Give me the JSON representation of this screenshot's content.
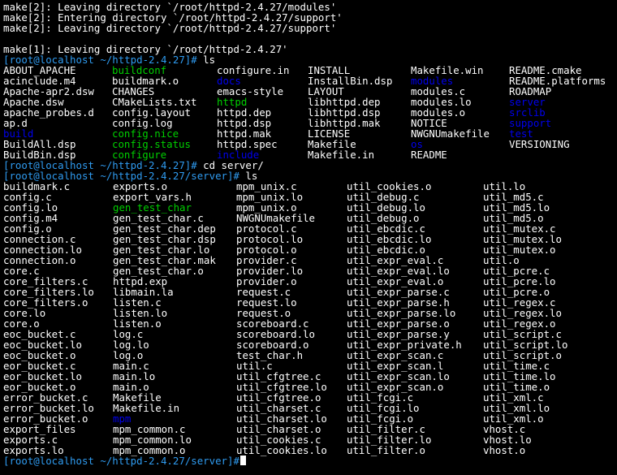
{
  "colors": {
    "background": "#000000",
    "text": "#ffffff",
    "prompt": "#2f9bf0",
    "directory": "#0000ee",
    "executable": "#00d000",
    "symlink": "#00ced1"
  },
  "make_lines": [
    "make[2]: Leaving directory `/root/httpd-2.4.27/modules'",
    "make[2]: Entering directory `/root/httpd-2.4.27/support'",
    "make[2]: Leaving directory `/root/httpd-2.4.27/support'",
    "",
    "make[1]: Leaving directory `/root/httpd-2.4.27'"
  ],
  "commands": [
    {
      "prompt": "[root@localhost ~/httpd-2.4.27]#",
      "command": " ls"
    },
    {
      "prompt": "[root@localhost ~/httpd-2.4.27]#",
      "command": " cd server/"
    },
    {
      "prompt": "[root@localhost ~/httpd-2.4.27/server]#",
      "command": " ls"
    },
    {
      "prompt": "[root@localhost ~/httpd-2.4.27/server]#",
      "command": ""
    }
  ],
  "listing1": [
    [
      "ABOUT_APACHE",
      "buildconf",
      "configure.in",
      "INSTALL",
      "Makefile.win",
      "README.cmake"
    ],
    [
      "acinclude.m4",
      "buildmark.o",
      "docs",
      "InstallBin.dsp",
      "modules",
      "README.platforms"
    ],
    [
      "Apache-apr2.dsw",
      "CHANGES",
      "emacs-style",
      "LAYOUT",
      "modules.c",
      "ROADMAP"
    ],
    [
      "Apache.dsw",
      "CMakeLists.txt",
      "httpd",
      "libhttpd.dep",
      "modules.lo",
      "server"
    ],
    [
      "apache_probes.d",
      "config.layout",
      "httpd.dep",
      "libhttpd.dsp",
      "modules.o",
      "srclib"
    ],
    [
      "ap.d",
      "config.log",
      "httpd.dsp",
      "libhttpd.mak",
      "NOTICE",
      "support"
    ],
    [
      "build",
      "config.nice",
      "httpd.mak",
      "LICENSE",
      "NWGNUmakefile",
      "test"
    ],
    [
      "BuildAll.dsp",
      "config.status",
      "httpd.spec",
      "Makefile",
      "os",
      "VERSIONING"
    ],
    [
      "BuildBin.dsp",
      "configure",
      "include",
      "Makefile.in",
      "README",
      ""
    ]
  ],
  "listing1_types": [
    [
      "f",
      "x",
      "f",
      "f",
      "f",
      "f"
    ],
    [
      "f",
      "f",
      "d",
      "f",
      "d",
      "f"
    ],
    [
      "f",
      "f",
      "f",
      "f",
      "f",
      "f"
    ],
    [
      "f",
      "f",
      "x",
      "f",
      "f",
      "d"
    ],
    [
      "f",
      "f",
      "f",
      "f",
      "f",
      "d"
    ],
    [
      "f",
      "f",
      "f",
      "f",
      "f",
      "d"
    ],
    [
      "d",
      "x",
      "f",
      "f",
      "f",
      "d"
    ],
    [
      "f",
      "x",
      "f",
      "f",
      "d",
      "f"
    ],
    [
      "f",
      "x",
      "d",
      "f",
      "f",
      "f"
    ]
  ],
  "listing2": [
    [
      "buildmark.c",
      "exports.o",
      "mpm_unix.c",
      "util_cookies.o",
      "util.lo"
    ],
    [
      "config.c",
      "export_vars.h",
      "mpm_unix.lo",
      "util_debug.c",
      "util_md5.c"
    ],
    [
      "config.lo",
      "gen_test_char",
      "mpm_unix.o",
      "util_debug.lo",
      "util_md5.lo"
    ],
    [
      "config.m4",
      "gen_test_char.c",
      "NWGNUmakefile",
      "util_debug.o",
      "util_md5.o"
    ],
    [
      "config.o",
      "gen_test_char.dep",
      "protocol.c",
      "util_ebcdic.c",
      "util_mutex.c"
    ],
    [
      "connection.c",
      "gen_test_char.dsp",
      "protocol.lo",
      "util_ebcdic.lo",
      "util_mutex.lo"
    ],
    [
      "connection.lo",
      "gen_test_char.lo",
      "protocol.o",
      "util_ebcdic.o",
      "util_mutex.o"
    ],
    [
      "connection.o",
      "gen_test_char.mak",
      "provider.c",
      "util_expr_eval.c",
      "util.o"
    ],
    [
      "core.c",
      "gen_test_char.o",
      "provider.lo",
      "util_expr_eval.lo",
      "util_pcre.c"
    ],
    [
      "core_filters.c",
      "httpd.exp",
      "provider.o",
      "util_expr_eval.o",
      "util_pcre.lo"
    ],
    [
      "core_filters.lo",
      "libmain.la",
      "request.c",
      "util_expr_parse.c",
      "util_pcre.o"
    ],
    [
      "core_filters.o",
      "listen.c",
      "request.lo",
      "util_expr_parse.h",
      "util_regex.c"
    ],
    [
      "core.lo",
      "listen.lo",
      "request.o",
      "util_expr_parse.lo",
      "util_regex.lo"
    ],
    [
      "core.o",
      "listen.o",
      "scoreboard.c",
      "util_expr_parse.o",
      "util_regex.o"
    ],
    [
      "eoc_bucket.c",
      "log.c",
      "scoreboard.lo",
      "util_expr_parse.y",
      "util_script.c"
    ],
    [
      "eoc_bucket.lo",
      "log.lo",
      "scoreboard.o",
      "util_expr_private.h",
      "util_script.lo"
    ],
    [
      "eoc_bucket.o",
      "log.o",
      "test_char.h",
      "util_expr_scan.c",
      "util_script.o"
    ],
    [
      "eor_bucket.c",
      "main.c",
      "util.c",
      "util_expr_scan.l",
      "util_time.c"
    ],
    [
      "eor_bucket.lo",
      "main.lo",
      "util_cfgtree.c",
      "util_expr_scan.lo",
      "util_time.lo"
    ],
    [
      "eor_bucket.o",
      "main.o",
      "util_cfgtree.lo",
      "util_expr_scan.o",
      "util_time.o"
    ],
    [
      "error_bucket.c",
      "Makefile",
      "util_cfgtree.o",
      "util_fcgi.c",
      "util_xml.c"
    ],
    [
      "error_bucket.lo",
      "Makefile.in",
      "util_charset.c",
      "util_fcgi.lo",
      "util_xml.lo"
    ],
    [
      "error_bucket.o",
      "mpm",
      "util_charset.lo",
      "util_fcgi.o",
      "util_xml.o"
    ],
    [
      "export_files",
      "mpm_common.c",
      "util_charset.o",
      "util_filter.c",
      "vhost.c"
    ],
    [
      "exports.c",
      "mpm_common.lo",
      "util_cookies.c",
      "util_filter.lo",
      "vhost.lo"
    ],
    [
      "exports.lo",
      "mpm_common.o",
      "util_cookies.lo",
      "util_filter.o",
      "vhost.o"
    ]
  ],
  "listing2_special": {
    "2,1": "x",
    "22,1": "d"
  }
}
